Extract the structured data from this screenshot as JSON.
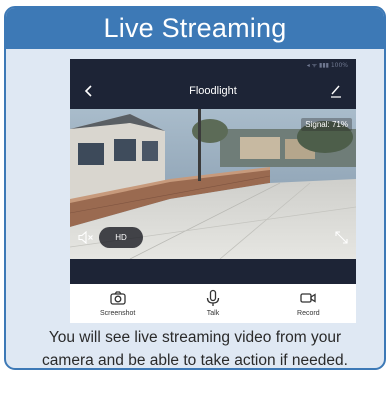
{
  "header": {
    "title": "Live Streaming"
  },
  "app": {
    "title": "Floodlight",
    "status_icons": "◂ ᯤ ▮▮▮ 100%"
  },
  "video": {
    "signal_text": "Signal: 71%",
    "quality_label": "HD"
  },
  "toolbar": {
    "items": [
      {
        "label": "Screenshot",
        "icon": "camera-icon"
      },
      {
        "label": "Talk",
        "icon": "microphone-icon"
      },
      {
        "label": "Record",
        "icon": "video-camera-icon"
      }
    ]
  },
  "caption": {
    "line1": "You will see live streaming video from your",
    "line2": "camera and be able to take action if needed."
  },
  "colors": {
    "header_blue": "#3d79b6",
    "card_background": "#dfe8f3",
    "app_bar_dark": "#1d2436"
  }
}
